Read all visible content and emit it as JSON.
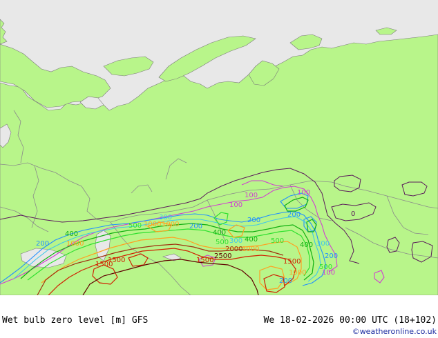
{
  "map": {
    "colors": {
      "land": "#b8f58a",
      "ocean": "#e8e8e8",
      "border": "#8a8a8a",
      "coast": "#7a7a7a",
      "c100": "#d040d0",
      "c200": "#2090ff",
      "c300": "#40c8e8",
      "c400": "#10b010",
      "c500": "#30e030",
      "c1000": "#ffa020",
      "c1500": "#d02000",
      "c2000": "#a03010",
      "c2500": "#600000",
      "c0": "#5a1a5a"
    },
    "contour_labels": [
      {
        "text": "100",
        "level": "c100"
      },
      {
        "text": "100",
        "level": "c100"
      },
      {
        "text": "100",
        "level": "c100"
      },
      {
        "text": "100",
        "level": "c100"
      },
      {
        "text": "200",
        "level": "c200"
      },
      {
        "text": "200",
        "level": "c200"
      },
      {
        "text": "200",
        "level": "c200"
      },
      {
        "text": "200",
        "level": "c200"
      },
      {
        "text": "200",
        "level": "c200"
      },
      {
        "text": "200",
        "level": "c200"
      },
      {
        "text": "300",
        "level": "c300"
      },
      {
        "text": "300",
        "level": "c300"
      },
      {
        "text": "300",
        "level": "c300"
      },
      {
        "text": "400",
        "level": "c400"
      },
      {
        "text": "400",
        "level": "c400"
      },
      {
        "text": "400",
        "level": "c400"
      },
      {
        "text": "400",
        "level": "c400"
      },
      {
        "text": "500",
        "level": "c500"
      },
      {
        "text": "500",
        "level": "c500"
      },
      {
        "text": "500",
        "level": "c500"
      },
      {
        "text": "500",
        "level": "c500"
      },
      {
        "text": "1000",
        "level": "c1000"
      },
      {
        "text": "1000",
        "level": "c1000"
      },
      {
        "text": "1000",
        "level": "c1000"
      },
      {
        "text": "1000",
        "level": "c1000"
      },
      {
        "text": "1000",
        "level": "c1000"
      },
      {
        "text": "1500",
        "level": "c1500"
      },
      {
        "text": "1500",
        "level": "c1500"
      },
      {
        "text": "1500",
        "level": "c1500"
      },
      {
        "text": "1500",
        "level": "c1500"
      },
      {
        "text": "2000",
        "level": "c2000"
      },
      {
        "text": "2500",
        "level": "c2500"
      },
      {
        "text": "0",
        "level": "c0"
      }
    ]
  },
  "footer": {
    "title_left": "Wet bulb zero level [m] GFS",
    "title_right": "We 18-02-2026 00:00 UTC (18+102)",
    "credit": "©weatheronline.co.uk"
  }
}
